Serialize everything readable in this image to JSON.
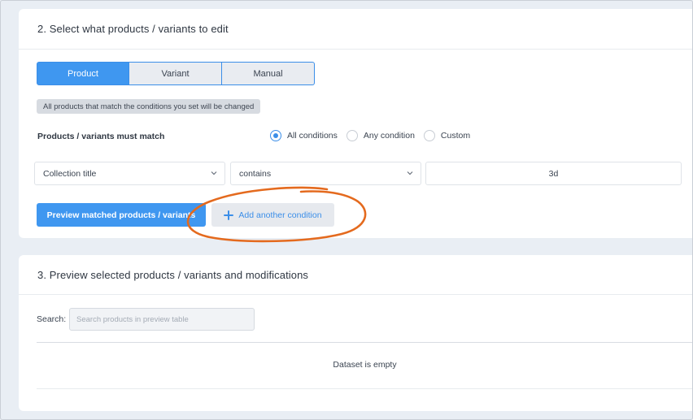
{
  "section2": {
    "title": "2. Select what products / variants to edit",
    "tabs": [
      {
        "label": "Product",
        "active": true
      },
      {
        "label": "Variant",
        "active": false
      },
      {
        "label": "Manual",
        "active": false
      }
    ],
    "note": "All products that match the conditions you set will be changed",
    "match_label": "Products / variants must match",
    "match_options": [
      {
        "label": "All conditions",
        "selected": true
      },
      {
        "label": "Any condition",
        "selected": false
      },
      {
        "label": "Custom",
        "selected": false
      }
    ],
    "condition": {
      "field": "Collection title",
      "operator": "contains",
      "value": "3d"
    },
    "preview_button": "Preview matched products / variants",
    "add_condition_button": "Add another condition"
  },
  "section3": {
    "title": "3. Preview selected products / variants and modifications",
    "search_label": "Search:",
    "search_placeholder": "Search products in preview table",
    "empty_text": "Dataset is empty"
  },
  "colors": {
    "accent": "#3f97f0",
    "annotation": "#e46a1e"
  }
}
